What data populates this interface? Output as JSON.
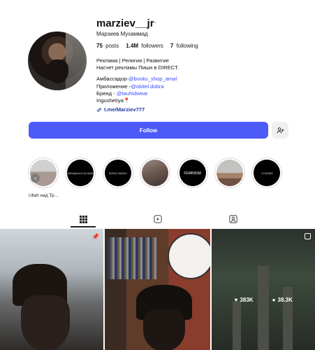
{
  "profile": {
    "username": "marziev__jr",
    "more_label": "···",
    "full_name": "Марзиев Мухаммад",
    "stats": [
      {
        "value": "75",
        "label": "posts"
      },
      {
        "value": "1.4M",
        "label": "followers"
      },
      {
        "value": "7",
        "label": "following"
      }
    ],
    "bio": {
      "line1": "Реклама | Религия | Развитие",
      "line2": "Насчет рекламы Пиши в DIRECT.",
      "ambassador_prefix": "Амбассадор-",
      "ambassador_link": "@books_shop_amal",
      "app_prefix": "Приложение -",
      "app_link": "@obitel.dobra",
      "brand_prefix": "Бренд - ",
      "brand_link": "@tauhidwear",
      "location": "Ingushetiya📍"
    },
    "link": "t.me/Marziev777"
  },
  "actions": {
    "follow_label": "Follow"
  },
  "highlights": [
    {
      "label": "",
      "style": "first"
    },
    {
      "label": "ЖЕНЩИНЫ В ИСЛАМЕ",
      "style": "dark"
    },
    {
      "label": "КОРАН НАЙЗАЧ",
      "style": "dark"
    },
    {
      "label": "",
      "style": "photo"
    },
    {
      "label": "FEMINISM",
      "style": "dark"
    },
    {
      "label": "",
      "style": "dune"
    },
    {
      "label": "УСЛОВИЯ",
      "style": "dark"
    }
  ],
  "highlight_first_label": "Ullah над Тр...",
  "tabs": [
    {
      "name": "posts",
      "icon": "grid-icon"
    },
    {
      "name": "reels",
      "icon": "reels-icon"
    },
    {
      "name": "tagged",
      "icon": "tagged-icon"
    }
  ],
  "posts": [
    {
      "id": 1,
      "pinned": true
    },
    {
      "id": 2,
      "pinned": false
    },
    {
      "id": 3,
      "likes": "383K",
      "comments": "38.3K"
    }
  ],
  "colors": {
    "accent": "#4c5bf8",
    "link": "#3b4cff"
  }
}
